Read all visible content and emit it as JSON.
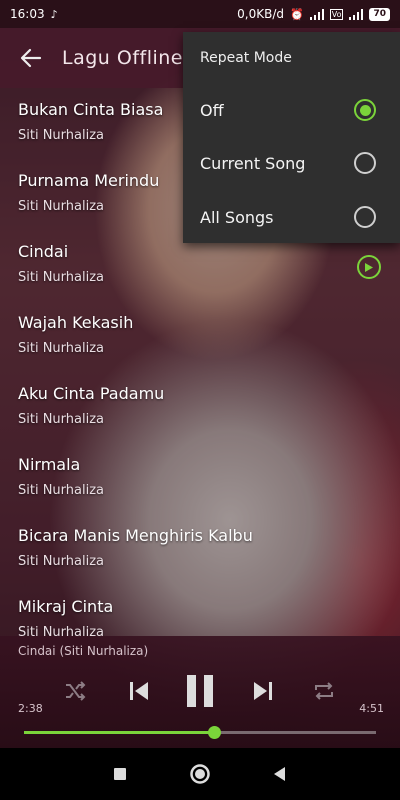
{
  "status_bar": {
    "time": "16:03",
    "network_speed": "0,0KB/d",
    "battery": "70",
    "icons": [
      "music-note-icon",
      "alarm-icon",
      "signal-icon",
      "volte-icon",
      "wifi-icon",
      "battery-icon"
    ]
  },
  "toolbar": {
    "title": "Lagu Offline"
  },
  "songs": [
    {
      "title": "Bukan Cinta Biasa",
      "artist": "Siti Nurhaliza"
    },
    {
      "title": "Purnama Merindu",
      "artist": "Siti Nurhaliza"
    },
    {
      "title": "Cindai",
      "artist": "Siti Nurhaliza"
    },
    {
      "title": "Wajah Kekasih",
      "artist": "Siti Nurhaliza"
    },
    {
      "title": "Aku Cinta Padamu",
      "artist": "Siti Nurhaliza"
    },
    {
      "title": "Nirmala",
      "artist": "Siti Nurhaliza"
    },
    {
      "title": "Bicara Manis Menghiris Kalbu",
      "artist": "Siti Nurhaliza"
    },
    {
      "title": "Mikraj Cinta",
      "artist": "Siti Nurhaliza"
    }
  ],
  "player": {
    "now_playing": "Cindai (Siti Nurhaliza)",
    "elapsed": "2:38",
    "duration": "4:51",
    "progress": 0.54
  },
  "repeat_menu": {
    "title": "Repeat Mode",
    "options": [
      {
        "label": "Off",
        "selected": true
      },
      {
        "label": "Current Song",
        "selected": false
      },
      {
        "label": "All Songs",
        "selected": false
      }
    ]
  },
  "colors": {
    "accent": "#7bd43a",
    "toolbar": "#461a2a",
    "popup": "#2f2f2f"
  }
}
